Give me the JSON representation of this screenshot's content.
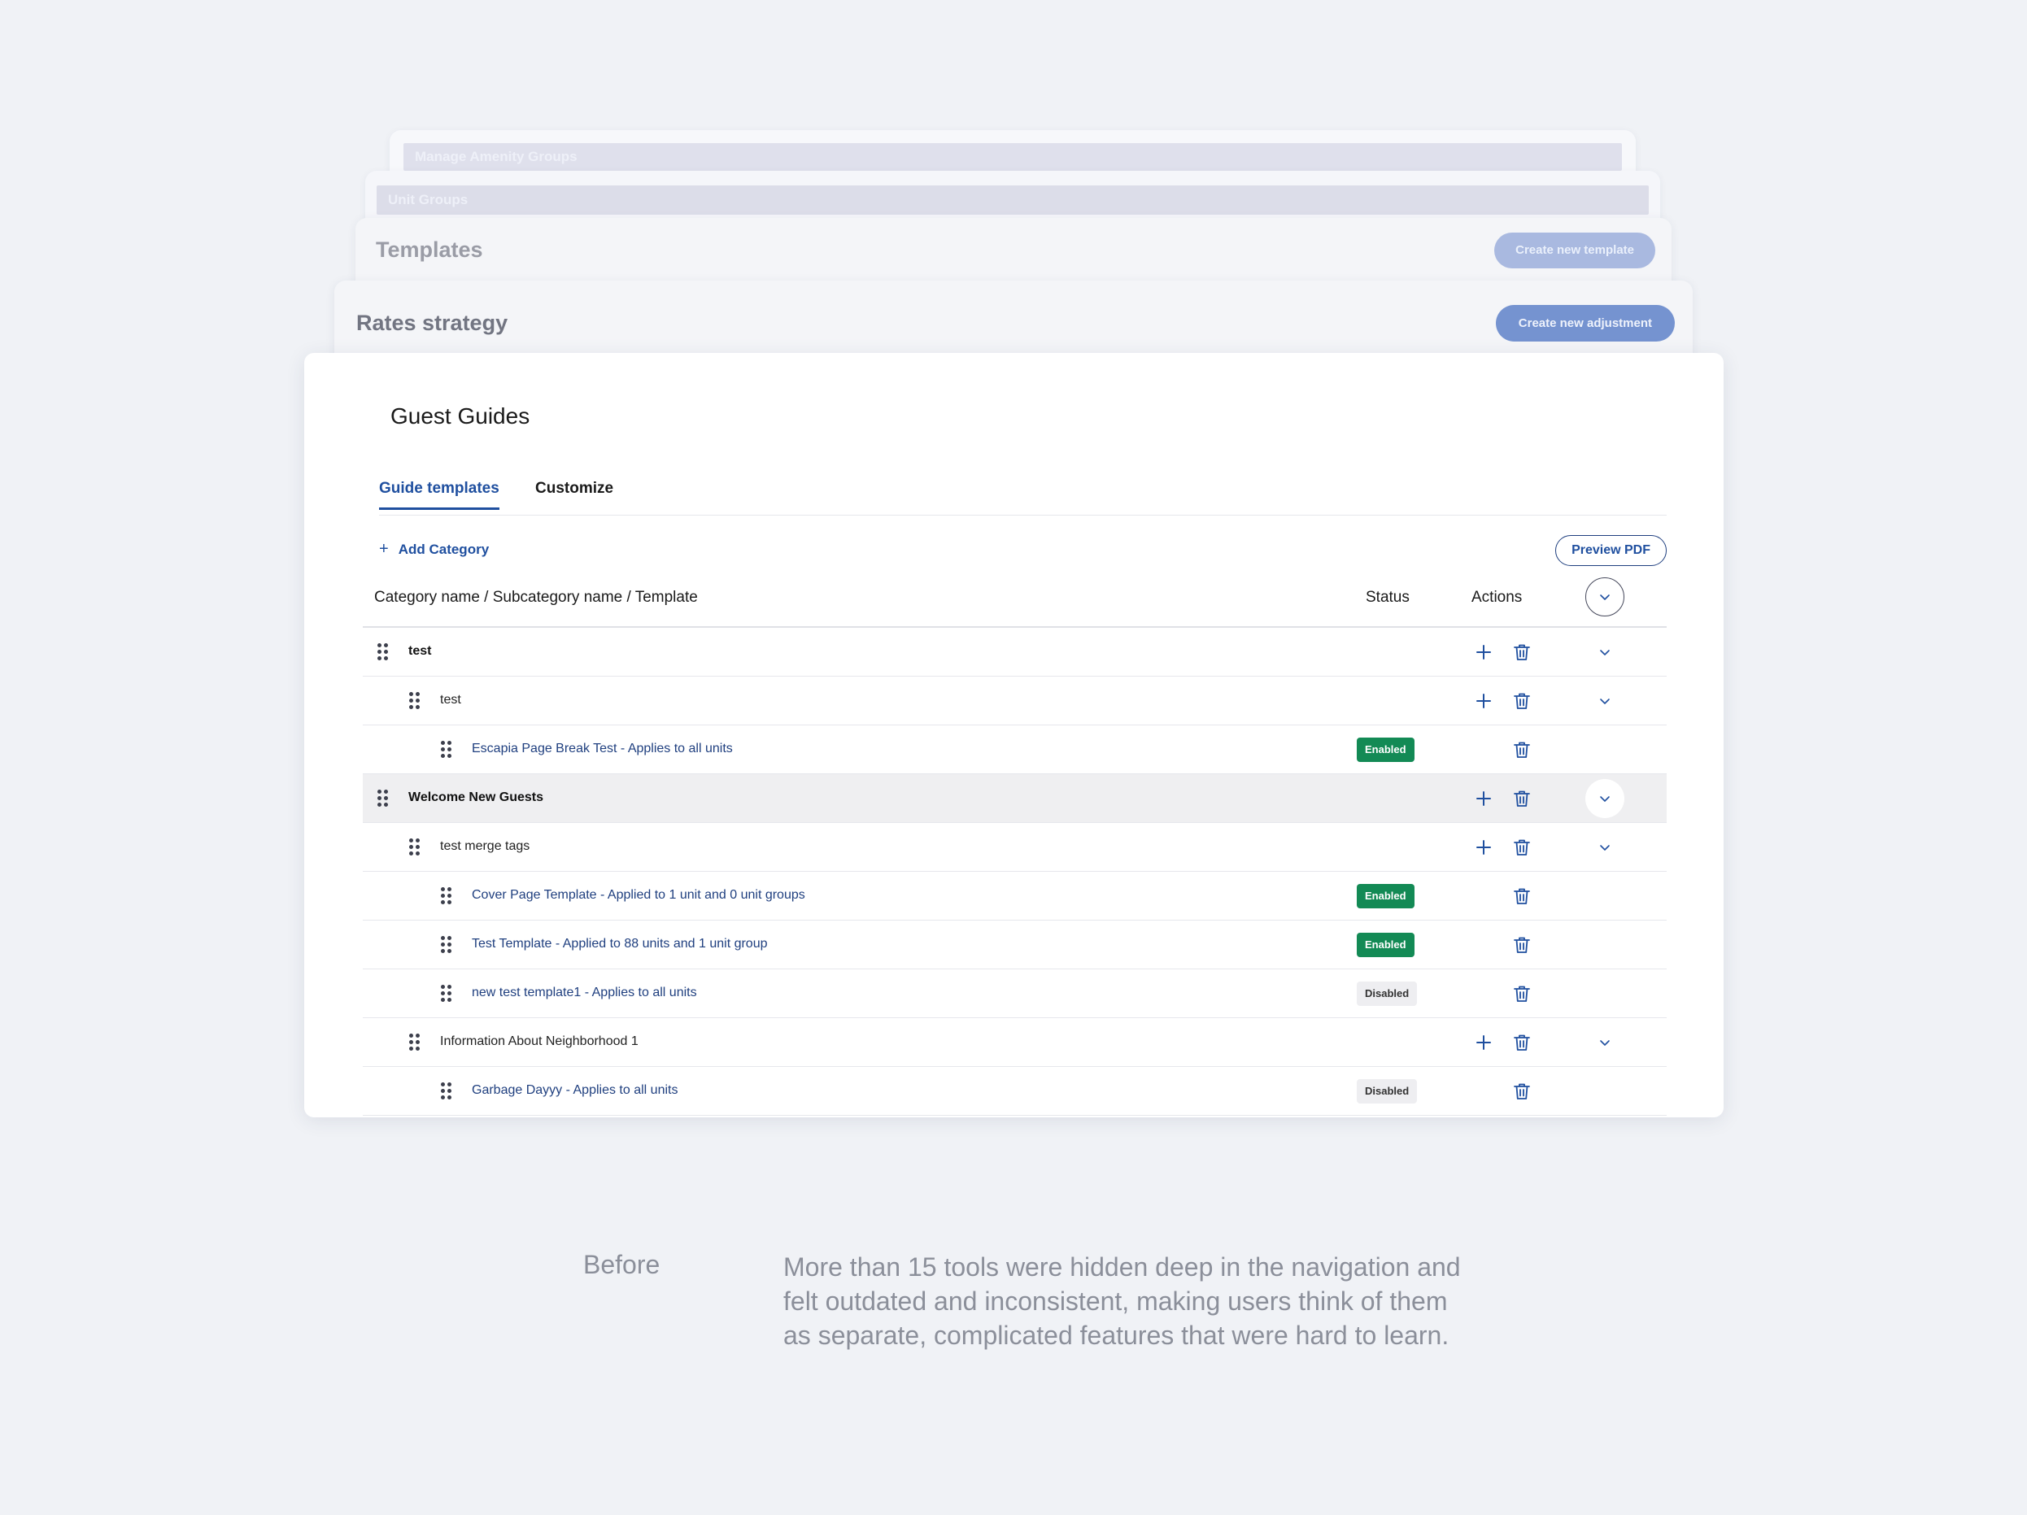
{
  "stack": {
    "amenity_groups_title": "Manage Amenity Groups",
    "unit_groups_title": "Unit Groups",
    "templates": {
      "title": "Templates",
      "button": "Create new template"
    },
    "rates": {
      "title": "Rates strategy",
      "button": "Create new adjustment"
    }
  },
  "guides": {
    "title": "Guest Guides",
    "tabs": [
      {
        "label": "Guide templates",
        "active": true
      },
      {
        "label": "Customize",
        "active": false
      }
    ],
    "add_category": "Add Category",
    "preview_pdf": "Preview PDF",
    "columns": {
      "name": "Category name / Subcategory name / Template",
      "status": "Status",
      "actions": "Actions"
    },
    "rows": [
      {
        "level": 0,
        "label": "test"
      },
      {
        "level": 1,
        "label": "test"
      },
      {
        "level": 2,
        "label": "Escapia Page Break Test - Applies to all units",
        "status": "Enabled"
      },
      {
        "level": 0,
        "label": "Welcome New Guests"
      },
      {
        "level": 1,
        "label": "test merge tags"
      },
      {
        "level": 2,
        "label": "Cover Page Template - Applied to 1 unit and 0 unit groups",
        "status": "Enabled"
      },
      {
        "level": 2,
        "label": "Test Template - Applied to 88 units and 1 unit group",
        "status": "Enabled"
      },
      {
        "level": 2,
        "label": "new test template1 - Applies to all units",
        "status": "Disabled"
      },
      {
        "level": 1,
        "label": "Information About Neighborhood 1"
      },
      {
        "level": 2,
        "label": "Garbage Dayyy - Applies to all units",
        "status": "Disabled"
      }
    ]
  },
  "caption": {
    "label": "Before",
    "text": "More than 15 tools were hidden deep in the navigation and felt outdated and inconsistent, making users think of them as separate, complicated features that were hard to learn."
  },
  "colors": {
    "accent": "#1f4f9f",
    "enabled": "#138a55",
    "disabled_bg": "#eeeef1",
    "background": "#f0f2f6"
  }
}
